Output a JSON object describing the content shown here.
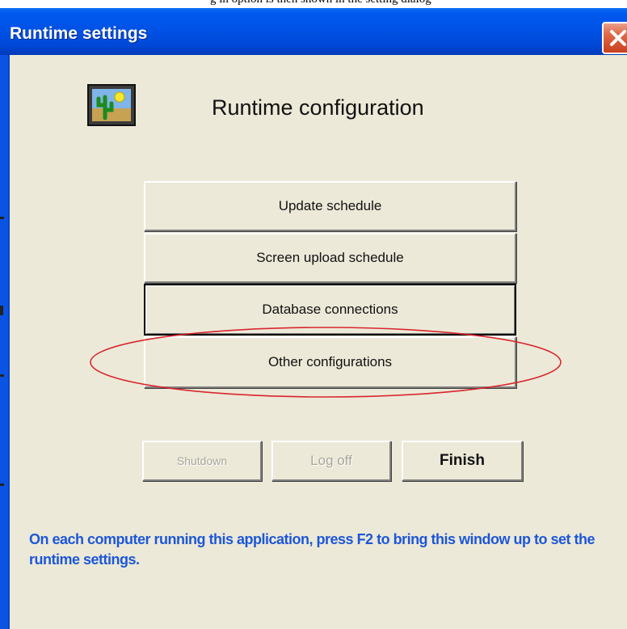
{
  "window": {
    "title": "Runtime settings",
    "close_icon": "close-icon"
  },
  "page_scrap": {
    "text": "g in option is then shown in the setting dialog"
  },
  "header": {
    "icon": "cactus-sun-app-icon",
    "heading": "Runtime configuration"
  },
  "config_buttons": [
    {
      "label": "Update schedule"
    },
    {
      "label": "Screen upload schedule"
    },
    {
      "label": "Database connections",
      "focused": true
    },
    {
      "label": "Other configurations",
      "highlighted": true
    }
  ],
  "highlight": {
    "color": "#d9262e"
  },
  "actions": {
    "shutdown": {
      "label": "Shutdown",
      "enabled": false
    },
    "logoff": {
      "label": "Log off",
      "enabled": false
    },
    "finish": {
      "label": "Finish",
      "enabled": true
    }
  },
  "footer": {
    "note": "On each computer running this application, press F2 to bring this window up to set the runtime settings.",
    "color": "#1d57d8"
  },
  "colors": {
    "titlebar": "#0052e6",
    "dialog_bg": "#ece9d8",
    "close_button": "#e06b4b"
  }
}
